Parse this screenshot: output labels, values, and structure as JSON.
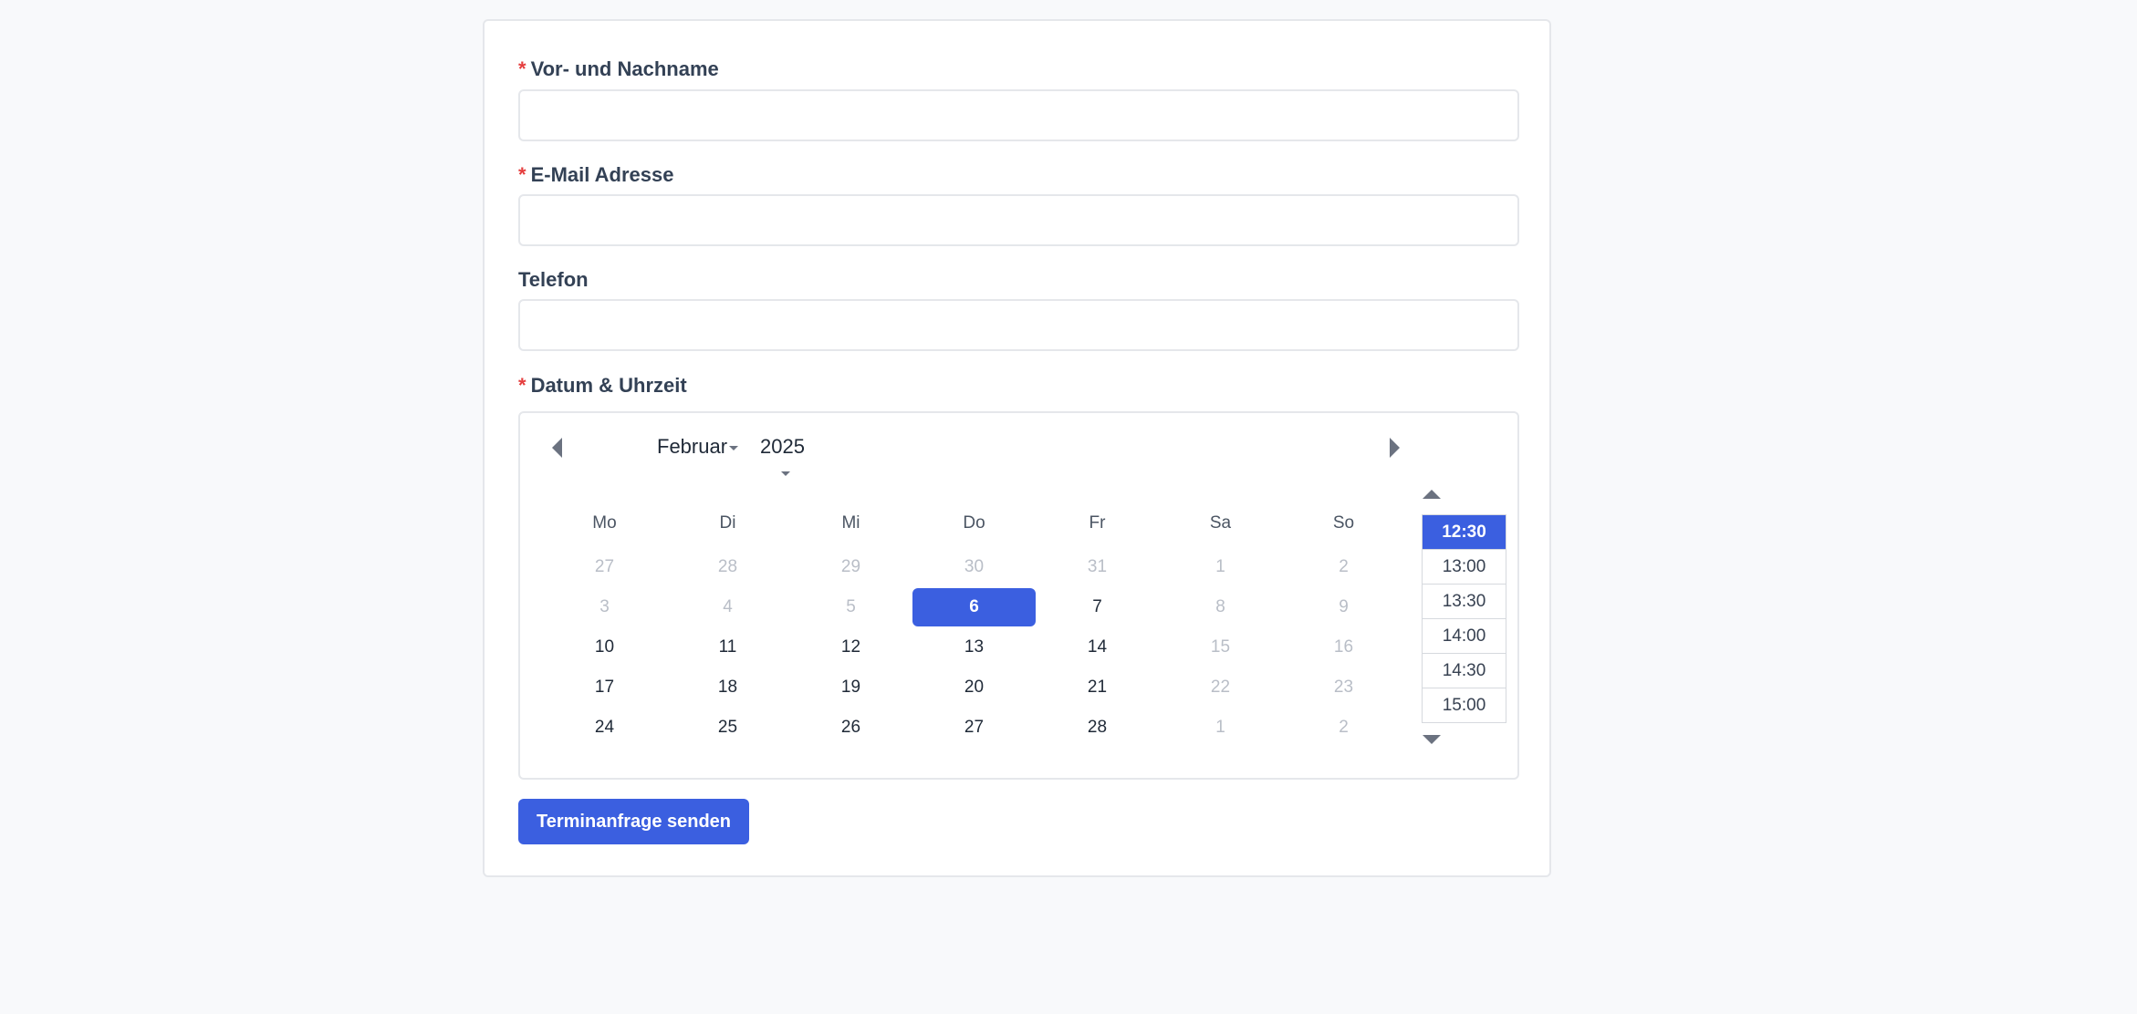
{
  "form": {
    "name": {
      "required_mark": "*",
      "label": "Vor- und Nachname",
      "value": ""
    },
    "email": {
      "required_mark": "*",
      "label": "E-Mail Adresse",
      "value": ""
    },
    "phone": {
      "label": "Telefon",
      "value": ""
    },
    "datetime": {
      "required_mark": "*",
      "label": "Datum & Uhrzeit"
    },
    "submit_label": "Terminanfrage senden"
  },
  "calendar": {
    "month": "Februar",
    "year": "2025",
    "weekdays": [
      "Mo",
      "Di",
      "Mi",
      "Do",
      "Fr",
      "Sa",
      "So"
    ],
    "weeks": [
      [
        {
          "d": "27",
          "muted": true
        },
        {
          "d": "28",
          "muted": true
        },
        {
          "d": "29",
          "muted": true
        },
        {
          "d": "30",
          "muted": true
        },
        {
          "d": "31",
          "muted": true
        },
        {
          "d": "1",
          "muted": true
        },
        {
          "d": "2",
          "muted": true
        }
      ],
      [
        {
          "d": "3",
          "muted": true
        },
        {
          "d": "4",
          "muted": true
        },
        {
          "d": "5",
          "muted": true
        },
        {
          "d": "6",
          "selected": true
        },
        {
          "d": "7"
        },
        {
          "d": "8",
          "muted": true
        },
        {
          "d": "9",
          "muted": true
        }
      ],
      [
        {
          "d": "10"
        },
        {
          "d": "11"
        },
        {
          "d": "12"
        },
        {
          "d": "13"
        },
        {
          "d": "14"
        },
        {
          "d": "15",
          "muted": true
        },
        {
          "d": "16",
          "muted": true
        }
      ],
      [
        {
          "d": "17"
        },
        {
          "d": "18"
        },
        {
          "d": "19"
        },
        {
          "d": "20"
        },
        {
          "d": "21"
        },
        {
          "d": "22",
          "muted": true
        },
        {
          "d": "23",
          "muted": true
        }
      ],
      [
        {
          "d": "24"
        },
        {
          "d": "25"
        },
        {
          "d": "26"
        },
        {
          "d": "27"
        },
        {
          "d": "28"
        },
        {
          "d": "1",
          "muted": true
        },
        {
          "d": "2",
          "muted": true
        }
      ]
    ],
    "times": [
      "12:30",
      "13:00",
      "13:30",
      "14:00",
      "14:30",
      "15:00"
    ],
    "selected_time": "12:30"
  },
  "colors": {
    "accent": "#3b5fe0",
    "required": "#e53e3e",
    "muted_day": "#b9bec7"
  },
  "icons": {
    "prev": "triangle-left-icon",
    "next": "triangle-right-icon",
    "time_up": "triangle-up-icon",
    "time_down": "triangle-down-icon",
    "caret": "caret-down-icon"
  }
}
